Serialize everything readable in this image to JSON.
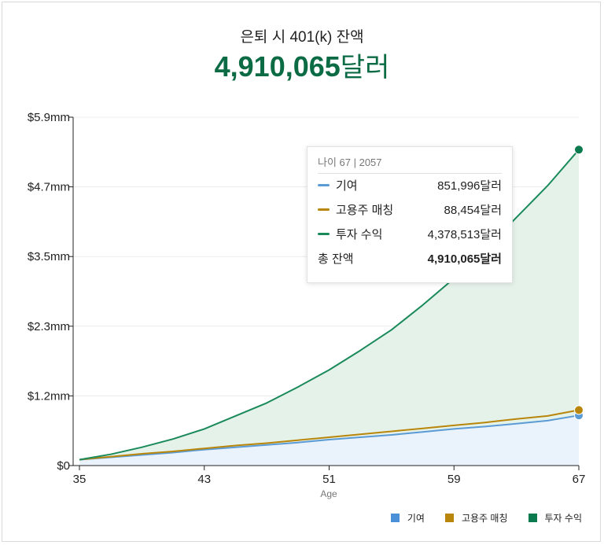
{
  "header": {
    "title": "은퇴 시 401(k) 잔액",
    "value_number": "4,910,065",
    "value_unit": "달러"
  },
  "tooltip": {
    "header": "나이 67 | 2057",
    "rows": [
      {
        "label": "기여",
        "value": "851,996달러",
        "color": "#5b9bd5"
      },
      {
        "label": "고용주 매칭",
        "value": "88,454달러",
        "color": "#b8860b"
      },
      {
        "label": "투자 수익",
        "value": "4,378,513달러",
        "color": "#1a8a5a"
      }
    ],
    "total_label": "총 잔액",
    "total_value": "4,910,065달러"
  },
  "legend": [
    {
      "label": "기여",
      "color": "#4a90d9"
    },
    {
      "label": "고용주 매칭",
      "color": "#b8860b"
    },
    {
      "label": "투자 수익",
      "color": "#0b7a4e"
    }
  ],
  "chart_data": {
    "type": "area",
    "xlabel": "Age",
    "x": [
      35,
      37,
      39,
      41,
      43,
      45,
      47,
      49,
      51,
      53,
      55,
      57,
      59,
      61,
      63,
      65,
      67
    ],
    "xticks": [
      35,
      43,
      51,
      59,
      67
    ],
    "yticks": [
      {
        "value": 0,
        "label": "$0"
      },
      {
        "value": 1.18,
        "label": "$1.2mm"
      },
      {
        "value": 2.36,
        "label": "$2.3mm"
      },
      {
        "value": 3.54,
        "label": "$3.5mm"
      },
      {
        "value": 4.72,
        "label": "$4.7mm"
      },
      {
        "value": 5.9,
        "label": "$5.9mm"
      }
    ],
    "ylim": [
      0,
      5.9
    ],
    "series": [
      {
        "name": "기여",
        "color": "#5b9bd5",
        "fill": "#eaf3fc",
        "values": [
          0.1,
          0.14,
          0.18,
          0.22,
          0.27,
          0.31,
          0.35,
          0.39,
          0.44,
          0.48,
          0.52,
          0.57,
          0.62,
          0.66,
          0.71,
          0.76,
          0.85
        ]
      },
      {
        "name": "고용주 매칭",
        "color": "#b8860b",
        "values": [
          0.1,
          0.15,
          0.2,
          0.24,
          0.29,
          0.34,
          0.38,
          0.43,
          0.48,
          0.53,
          0.58,
          0.63,
          0.68,
          0.73,
          0.79,
          0.84,
          0.94
        ]
      },
      {
        "name": "투자 수익",
        "color": "#1a8a5a",
        "fill": "#e5f2ea",
        "values": [
          0.1,
          0.19,
          0.31,
          0.45,
          0.62,
          0.84,
          1.06,
          1.33,
          1.62,
          1.95,
          2.3,
          2.72,
          3.17,
          3.66,
          4.2,
          4.74,
          5.35
        ]
      }
    ]
  }
}
